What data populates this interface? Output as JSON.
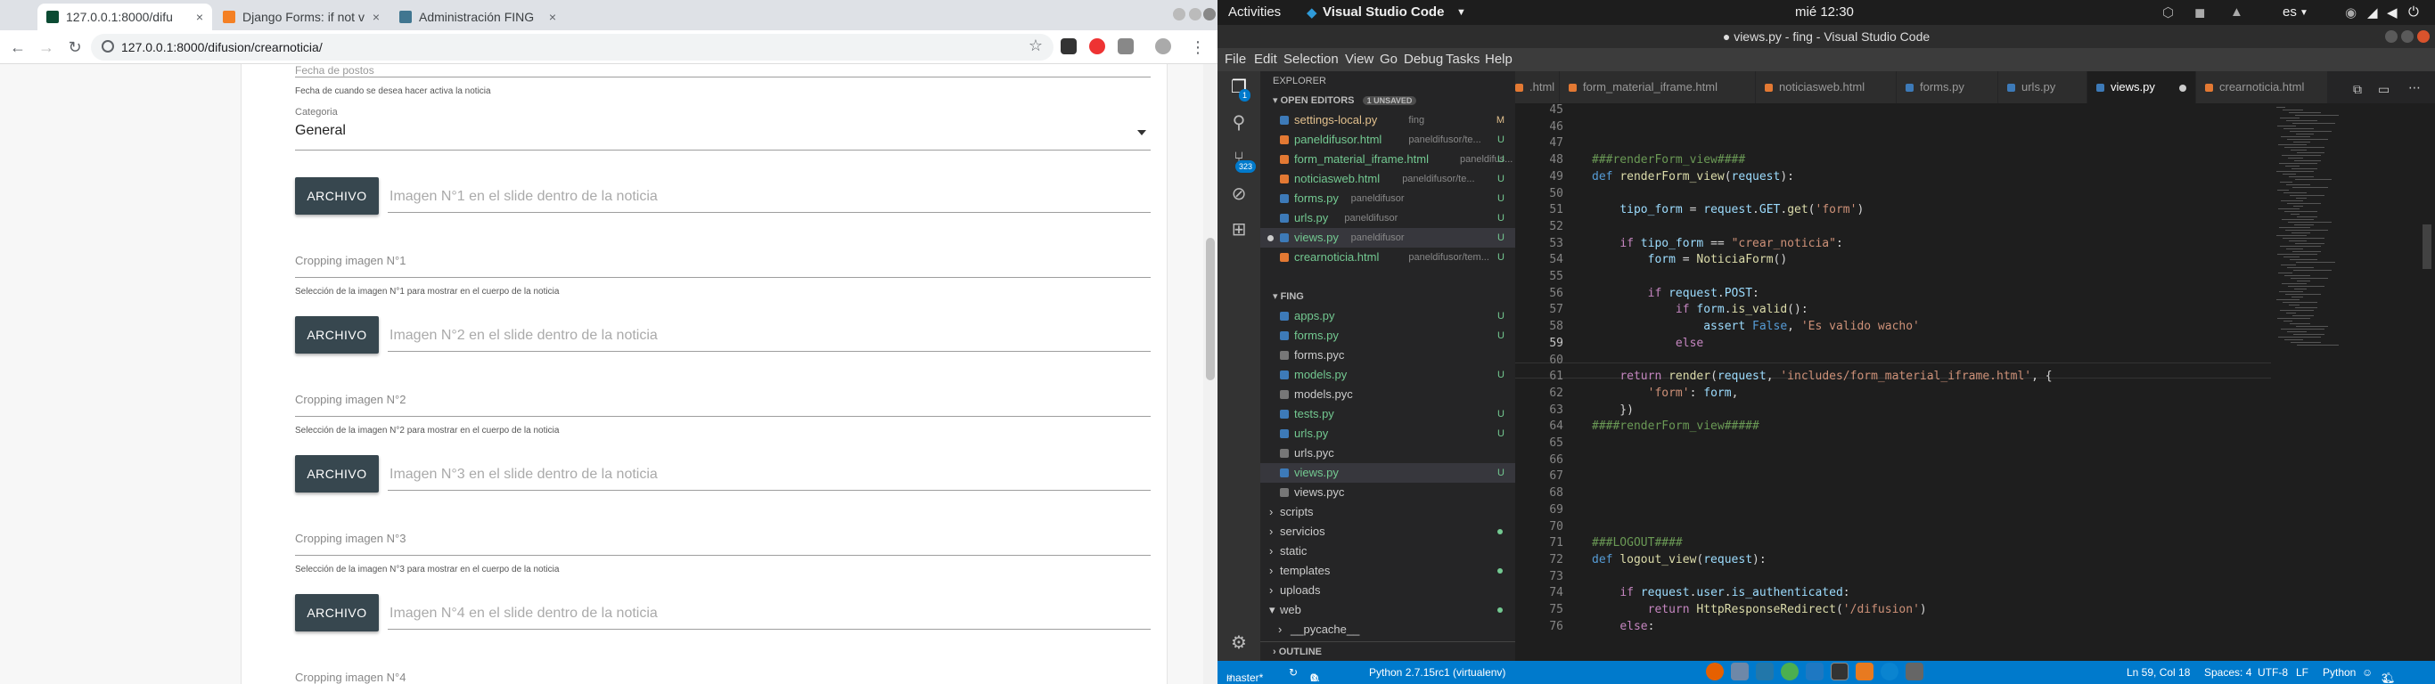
{
  "chrome": {
    "tabs": [
      {
        "title": "127.0.0.1:8000/difu",
        "active": true
      },
      {
        "title": "Django Forms: if not v",
        "active": false
      },
      {
        "title": "Administración FING",
        "active": false
      }
    ],
    "url": "127.0.0.1:8000/difusion/crearnoticia/",
    "form": {
      "fecha_cropped_label": "Fecha de postos",
      "fecha_helper": "Fecha de cuando se desea hacer activa la noticia",
      "categoria_label": "Categoria",
      "categoria_value": "General",
      "archivo_label": "ARCHIVO",
      "image_placeholders": [
        "Imagen N°1 en el slide dentro de la noticia",
        "Imagen N°2 en el slide dentro de la noticia",
        "Imagen N°3 en el slide dentro de la noticia",
        "Imagen N°4 en el slide dentro de la noticia"
      ],
      "cropping": [
        {
          "label": "Cropping imagen N°1",
          "helper": "Selección de la imagen N°1 para mostrar en el cuerpo de la noticia"
        },
        {
          "label": "Cropping imagen N°2",
          "helper": "Selección de la imagen N°2 para mostrar en el cuerpo de la noticia"
        },
        {
          "label": "Cropping imagen N°3",
          "helper": "Selección de la imagen N°3 para mostrar en el cuerpo de la noticia"
        },
        {
          "label": "Cropping imagen N°4",
          "helper": ""
        }
      ]
    }
  },
  "topbar": {
    "activities": "Activities",
    "app": "Visual Studio Code",
    "clock": "mié 12:30",
    "lang": "es"
  },
  "vscode": {
    "title": "● views.py - fing - Visual Studio Code",
    "menu": [
      "File",
      "Edit",
      "Selection",
      "View",
      "Go",
      "Debug",
      "Tasks",
      "Help"
    ],
    "badges": {
      "explorer": "1",
      "scm": "323"
    },
    "explorer_title": "EXPLORER",
    "open_editors": {
      "title": "OPEN EDITORS",
      "badge": "1 UNSAVED",
      "items": [
        {
          "name": "settings-local.py",
          "desc": "fing",
          "status": "M"
        },
        {
          "name": "paneldifusor.html",
          "desc": "paneldifusor/te...",
          "status": "U"
        },
        {
          "name": "form_material_iframe.html",
          "desc": "paneldifus...",
          "status": "U"
        },
        {
          "name": "noticiasweb.html",
          "desc": "paneldifusor/te...",
          "status": "U"
        },
        {
          "name": "forms.py",
          "desc": "paneldifusor",
          "status": "U"
        },
        {
          "name": "urls.py",
          "desc": "paneldifusor",
          "status": "U"
        },
        {
          "name": "views.py",
          "desc": "paneldifusor",
          "status": "U"
        },
        {
          "name": "crearnoticia.html",
          "desc": "paneldifusor/tem...",
          "status": "U"
        }
      ]
    },
    "fing": {
      "title": "FING",
      "items": [
        {
          "name": "apps.py",
          "status": "U"
        },
        {
          "name": "forms.py",
          "status": "U"
        },
        {
          "name": "forms.pyc",
          "status": ""
        },
        {
          "name": "models.py",
          "status": "U"
        },
        {
          "name": "models.pyc",
          "status": ""
        },
        {
          "name": "tests.py",
          "status": "U"
        },
        {
          "name": "urls.py",
          "status": "U"
        },
        {
          "name": "urls.pyc",
          "status": ""
        },
        {
          "name": "views.py",
          "status": "U"
        },
        {
          "name": "views.pyc",
          "status": ""
        }
      ],
      "folders": [
        "scripts",
        "servicios",
        "static",
        "templates",
        "uploads",
        "web",
        "__pycache__"
      ]
    },
    "outline": "OUTLINE",
    "tabs": [
      ".html",
      "form_material_iframe.html",
      "noticiasweb.html",
      "forms.py",
      "urls.py",
      "views.py",
      "crearnoticia.html"
    ],
    "code_lines": [
      {
        "n": "45",
        "t": ""
      },
      {
        "n": "46",
        "t": ""
      },
      {
        "n": "47",
        "t": ""
      },
      {
        "n": "48",
        "t": "###renderForm_view####"
      },
      {
        "n": "49",
        "t": "def renderForm_view(request):"
      },
      {
        "n": "50",
        "t": ""
      },
      {
        "n": "51",
        "t": "    tipo_form = request.GET.get('form')"
      },
      {
        "n": "52",
        "t": ""
      },
      {
        "n": "53",
        "t": "    if tipo_form == \"crear_noticia\":"
      },
      {
        "n": "54",
        "t": "        form = NoticiaForm()"
      },
      {
        "n": "55",
        "t": ""
      },
      {
        "n": "56",
        "t": "        if request.POST:"
      },
      {
        "n": "57",
        "t": "            if form.is_valid():"
      },
      {
        "n": "58",
        "t": "                assert False, 'Es valido wacho'"
      },
      {
        "n": "59",
        "t": "            else"
      },
      {
        "n": "60",
        "t": ""
      },
      {
        "n": "61",
        "t": "    return render(request, 'includes/form_material_iframe.html', {"
      },
      {
        "n": "62",
        "t": "        'form': form,"
      },
      {
        "n": "63",
        "t": "    })"
      },
      {
        "n": "64",
        "t": "####renderForm_view#####"
      },
      {
        "n": "65",
        "t": ""
      },
      {
        "n": "66",
        "t": ""
      },
      {
        "n": "67",
        "t": ""
      },
      {
        "n": "68",
        "t": ""
      },
      {
        "n": "69",
        "t": ""
      },
      {
        "n": "70",
        "t": ""
      },
      {
        "n": "71",
        "t": "###LOGOUT####"
      },
      {
        "n": "72",
        "t": "def logout_view(request):"
      },
      {
        "n": "73",
        "t": ""
      },
      {
        "n": "74",
        "t": "    if request.user.is_authenticated:"
      },
      {
        "n": "75",
        "t": "        return HttpResponseRedirect('/difusion')"
      },
      {
        "n": "76",
        "t": "    else:"
      }
    ],
    "status": {
      "branch": "master*",
      "errors": "0",
      "warnings": "0",
      "python": "Python 2.7.15rc1 (virtualenv)",
      "position": "Ln 59, Col 18",
      "spaces": "Spaces: 4",
      "encoding": "UTF-8",
      "eol": "LF",
      "language": "Python",
      "notifications": "3"
    }
  }
}
